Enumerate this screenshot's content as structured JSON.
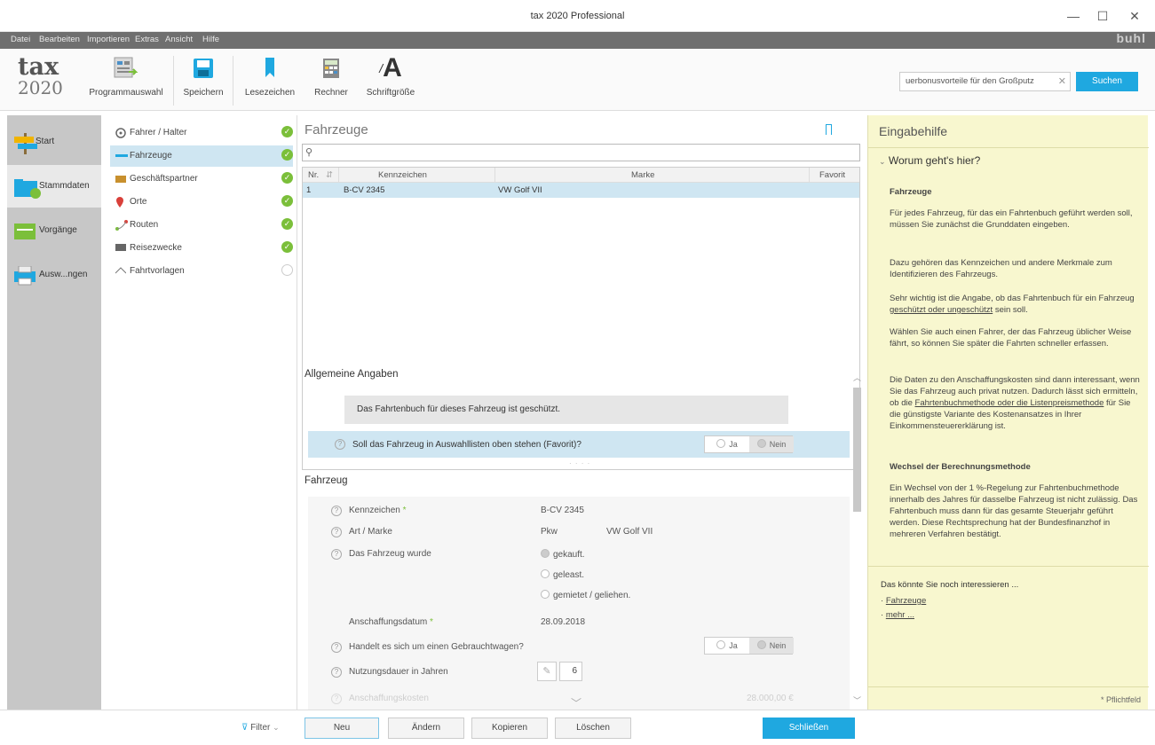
{
  "window": {
    "title": "tax 2020 Professional",
    "min": "—",
    "max": "☐",
    "close": "✕"
  },
  "menu": [
    "Datei",
    "Bearbeiten",
    "Importieren",
    "Extras",
    "Ansicht",
    "Hilfe"
  ],
  "brand": "buhl",
  "logo": {
    "line1": "tax",
    "line2": "2020"
  },
  "toolbar": [
    {
      "label": "Programmauswahl",
      "icon": "program-select-icon"
    },
    {
      "label": "Speichern",
      "icon": "save-icon"
    },
    {
      "label": "Lesezeichen",
      "icon": "bookmark-icon"
    },
    {
      "label": "Rechner",
      "icon": "calculator-icon"
    },
    {
      "label": "Schriftgröße",
      "icon": "font-size-icon"
    }
  ],
  "search": {
    "value": "uerbonusvorteile für den Großputz",
    "button": "Suchen"
  },
  "leftnav": [
    {
      "label": "Start",
      "active": false
    },
    {
      "label": "Stammdaten",
      "active": true
    },
    {
      "label": "Vorgänge",
      "active": false
    },
    {
      "label": "Ausw...ngen",
      "active": false
    }
  ],
  "subnav": [
    {
      "label": "Fahrer / Halter",
      "done": true,
      "active": false
    },
    {
      "label": "Fahrzeuge",
      "done": true,
      "active": true
    },
    {
      "label": "Geschäftspartner",
      "done": true,
      "active": false
    },
    {
      "label": "Orte",
      "done": true,
      "active": false
    },
    {
      "label": "Routen",
      "done": true,
      "active": false
    },
    {
      "label": "Reisezwecke",
      "done": true,
      "active": false
    },
    {
      "label": "Fahrtvorlagen",
      "done": false,
      "active": false
    }
  ],
  "center": {
    "title": "Fahrzeuge",
    "grid": {
      "headers": [
        "Nr.",
        "Kennzeichen",
        "Marke",
        "Favorit"
      ],
      "rows": [
        {
          "nr": "1",
          "kennzeichen": "B-CV 2345",
          "marke": "VW Golf VII",
          "favorit": ""
        }
      ]
    },
    "section_general": "Allgemeine Angaben",
    "info_protected": "Das Fahrtenbuch für dieses Fahrzeug ist geschützt.",
    "favorite_question": "Soll das Fahrzeug in Auswahllisten oben stehen (Favorit)?",
    "yes": "Ja",
    "no": "Nein",
    "section_vehicle": "Fahrzeug",
    "fields": {
      "kennzeichen_label": "Kennzeichen",
      "kennzeichen_value": "B-CV 2345",
      "art_label": "Art / Marke",
      "art_value": "Pkw",
      "marke_value": "VW Golf VII",
      "acquired_label": "Das Fahrzeug wurde",
      "opt_bought": "gekauft.",
      "opt_leased": "geleast.",
      "opt_rented": "gemietet / geliehen.",
      "date_label": "Anschaffungsdatum",
      "date_value": "28.09.2018",
      "used_label": "Handelt es sich um einen Gebrauchtwagen?",
      "usage_label": "Nutzungsdauer in Jahren",
      "usage_value": "6",
      "cost_label": "Anschaffungskosten",
      "cost_value": "28.000,00 €"
    }
  },
  "help": {
    "title": "Eingabehilfe",
    "subtitle": "Worum geht's hier?",
    "heading1": "Fahrzeuge",
    "p1": "Für jedes Fahrzeug, für das ein Fahrtenbuch geführt werden soll, müssen Sie zunächst die Grunddaten eingeben.",
    "p2": "Dazu gehören das Kennzeichen und andere Merkmale zum Identifizieren des Fahrzeugs.",
    "p3a": "Sehr wichtig ist die Angabe, ob das Fahrtenbuch für ein Fahrzeug ",
    "p3link": "geschützt oder ungeschützt",
    "p3b": " sein soll.",
    "p4": "Wählen Sie auch einen Fahrer, der das Fahrzeug üblicher Weise fährt, so können Sie später die Fahrten schneller erfassen.",
    "p5a": "Die Daten zu den Anschaffungskosten sind dann interessant, wenn Sie das Fahrzeug auch privat nutzen. Dadurch lässt sich ermitteln, ob die ",
    "p5link": "Fahrtenbuchmethode oder die Listenpreismethode",
    "p5b": " für Sie die günstigste Variante des Kostenansatzes in Ihrer Einkommensteuererklärung ist.",
    "heading2": "Wechsel der Berechnungsmethode",
    "p6": "Ein Wechsel von der 1 %-Regelung zur Fahrtenbuchmethode innerhalb des Jahres für dasselbe Fahrzeug ist nicht zulässig. Das Fahrtenbuch muss dann für das gesamte Steuerjahr geführt werden. Diese Rechtsprechung hat der Bundesfinanzhof in mehreren Verfahren bestätigt.",
    "more_title": "Das könnte Sie noch interessieren ...",
    "link1": "Fahrzeuge",
    "link2": "mehr ...",
    "required": "* Pflichtfeld"
  },
  "bottom": {
    "filter": "Filter",
    "buttons": [
      "Neu",
      "Ändern",
      "Kopieren",
      "Löschen"
    ],
    "close": "Schließen"
  },
  "colors": {
    "accent": "#1fa8e0",
    "selection": "#cfe6f2",
    "help_bg": "#f8f7cf",
    "check": "#7bbf3a"
  }
}
